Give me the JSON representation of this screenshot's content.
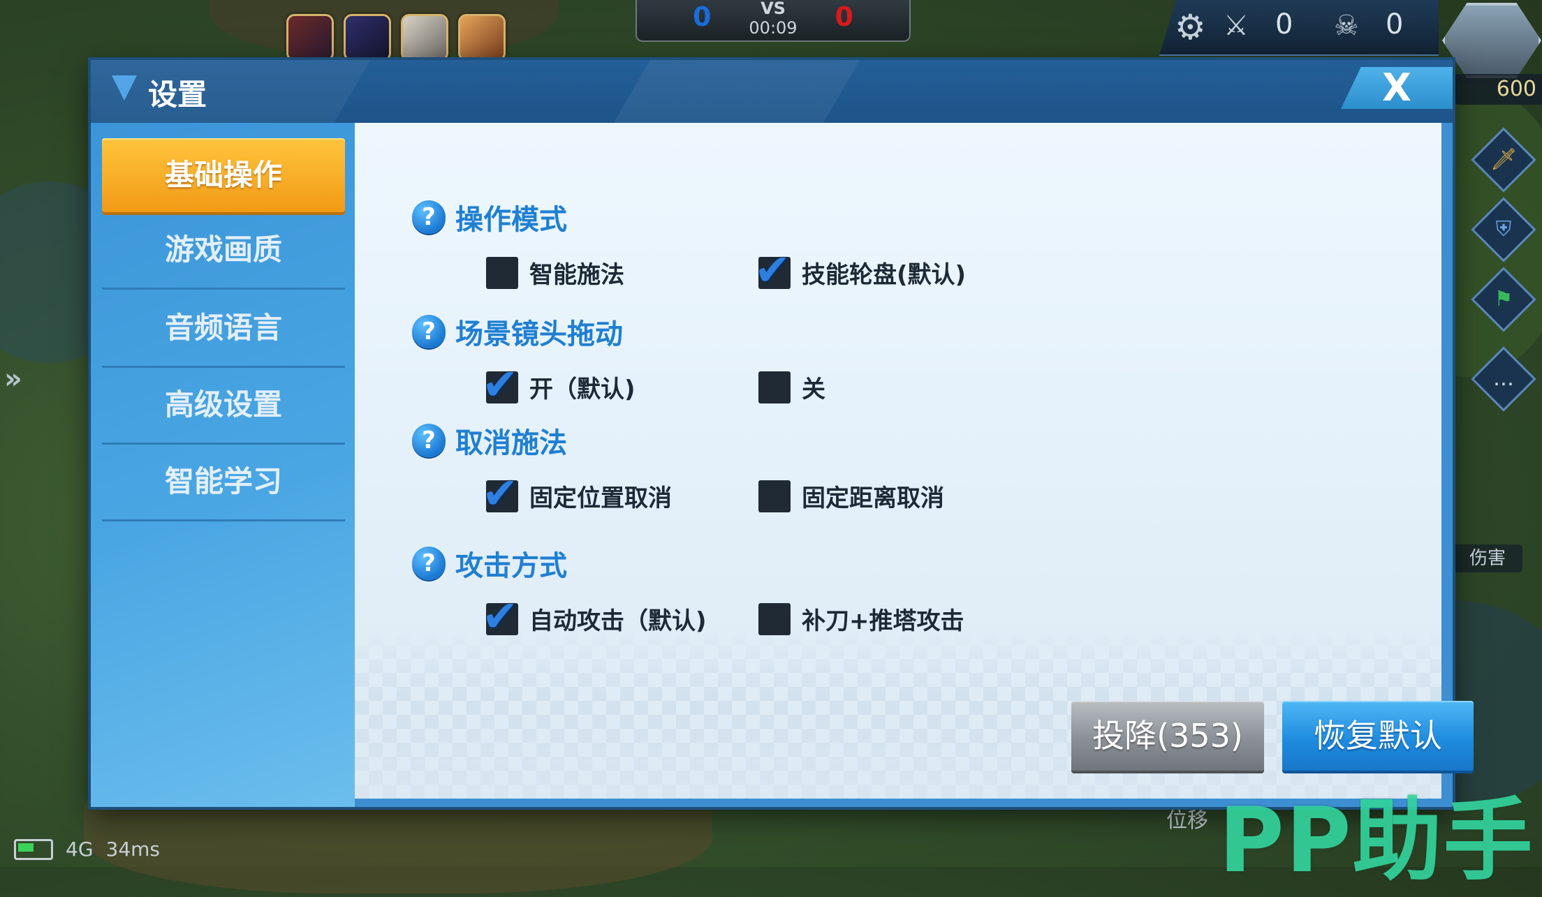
{
  "hud": {
    "vs_label": "VS",
    "timer": "00:09",
    "blue_score": "0",
    "red_score": "0",
    "kills": "0",
    "deaths": "0",
    "gold": "600",
    "hurt_label": "伤害",
    "dash_label": "位移",
    "network": "4G",
    "ping": "34ms"
  },
  "dialog": {
    "title": "设置",
    "close_label": "X"
  },
  "sidebar": {
    "items": [
      {
        "label": "基础操作",
        "active": true
      },
      {
        "label": "游戏画质",
        "active": false
      },
      {
        "label": "音频语言",
        "active": false
      },
      {
        "label": "高级设置",
        "active": false
      },
      {
        "label": "智能学习",
        "active": false
      }
    ]
  },
  "sections": [
    {
      "title": "操作模式",
      "options": [
        {
          "label": "智能施法",
          "checked": false
        },
        {
          "label": "技能轮盘(默认)",
          "checked": true
        }
      ]
    },
    {
      "title": "场景镜头拖动",
      "options": [
        {
          "label": "开（默认)",
          "checked": true
        },
        {
          "label": "关",
          "checked": false
        }
      ]
    },
    {
      "title": "取消施法",
      "options": [
        {
          "label": "固定位置取消",
          "checked": true
        },
        {
          "label": "固定距离取消",
          "checked": false
        }
      ]
    },
    {
      "title": "攻击方式",
      "options": [
        {
          "label": "自动攻击（默认)",
          "checked": true
        },
        {
          "label": "补刀+推塔攻击",
          "checked": false
        }
      ]
    }
  ],
  "buttons": {
    "surrender": "投降(353)",
    "restore_default": "恢复默认"
  },
  "watermark": "PP助手",
  "colors": {
    "accent_orange": "#f29a16",
    "accent_blue": "#1f7fd2",
    "panel_blue": "#3d8fd2",
    "checkbox_dark": "#1f2a35"
  }
}
